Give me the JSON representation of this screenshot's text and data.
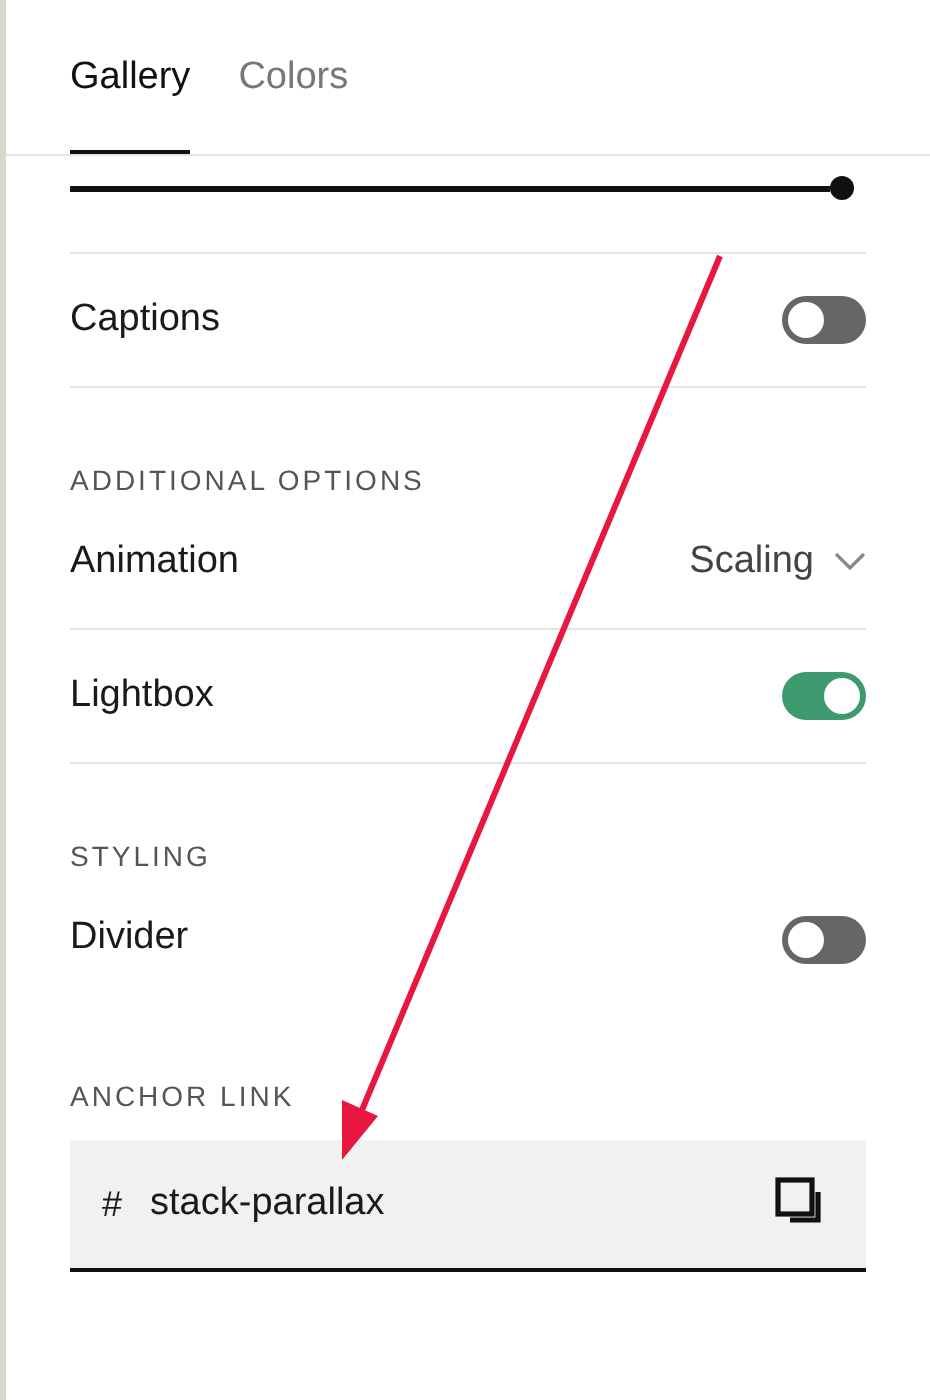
{
  "tabs": [
    {
      "label": "Gallery",
      "selected": true
    },
    {
      "label": "Colors",
      "selected": false
    }
  ],
  "slider": {
    "level": 1
  },
  "sections": [
    {
      "rows": [
        {
          "kind": "toggle",
          "label": "Captions",
          "on": false
        }
      ]
    },
    {
      "heading": "ADDITIONAL OPTIONS",
      "rows": [
        {
          "kind": "select",
          "label": "Animation",
          "value": "Scaling"
        },
        {
          "kind": "toggle",
          "label": "Lightbox",
          "on": true
        }
      ]
    },
    {
      "heading": "STYLING",
      "rows": [
        {
          "kind": "toggle",
          "label": "Divider",
          "on": false
        }
      ]
    }
  ],
  "anchor_link": {
    "heading": "ANCHOR LINK",
    "prefix": "#",
    "value": "stack-parallax"
  }
}
